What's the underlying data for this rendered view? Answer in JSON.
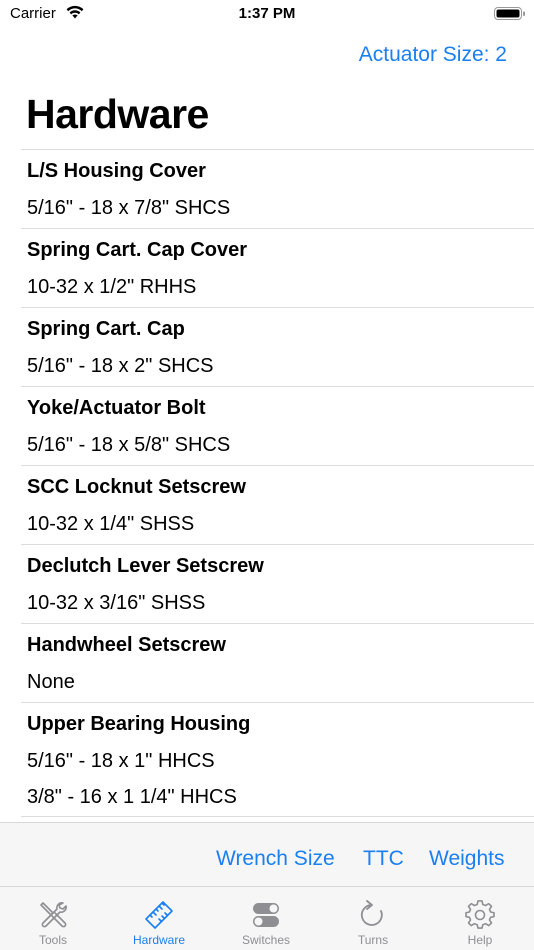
{
  "status_bar": {
    "carrier": "Carrier",
    "time": "1:37 PM"
  },
  "nav": {
    "right_button": "Actuator Size: 2",
    "title": "Hardware"
  },
  "rows": [
    {
      "title": "L/S Housing Cover",
      "values": [
        "5/16\" - 18 x 7/8\" SHCS"
      ]
    },
    {
      "title": "Spring Cart. Cap Cover",
      "values": [
        "10-32 x 1/2\" RHHS"
      ]
    },
    {
      "title": "Spring Cart. Cap",
      "values": [
        "5/16\" - 18 x 2\" SHCS"
      ]
    },
    {
      "title": "Yoke/Actuator Bolt",
      "values": [
        "5/16\" - 18 x 5/8\" SHCS"
      ]
    },
    {
      "title": "SCC Locknut Setscrew",
      "values": [
        "10-32 x 1/4\" SHSS"
      ]
    },
    {
      "title": "Declutch Lever Setscrew",
      "values": [
        "10-32 x 3/16\" SHSS"
      ]
    },
    {
      "title": "Handwheel Setscrew",
      "values": [
        "None"
      ]
    },
    {
      "title": "Upper Bearing Housing",
      "values": [
        "5/16\" - 18 x 1\" HHCS",
        "3/8\" - 16 x 1 1/4\" HHCS"
      ]
    }
  ],
  "toolbar": {
    "wrench_size": "Wrench Size",
    "ttc": "TTC",
    "weights": "Weights"
  },
  "tabs": [
    {
      "label": "Tools",
      "icon": "tools-icon",
      "active": false
    },
    {
      "label": "Hardware",
      "icon": "hardware-icon",
      "active": true
    },
    {
      "label": "Switches",
      "icon": "switches-icon",
      "active": false
    },
    {
      "label": "Turns",
      "icon": "turns-icon",
      "active": false
    },
    {
      "label": "Help",
      "icon": "gear-icon",
      "active": false
    }
  ],
  "colors": {
    "accent": "#1a7ff0",
    "inactive": "#8e8e93",
    "bar_background": "#f6f6f6",
    "separator": "#dcdcdc"
  }
}
